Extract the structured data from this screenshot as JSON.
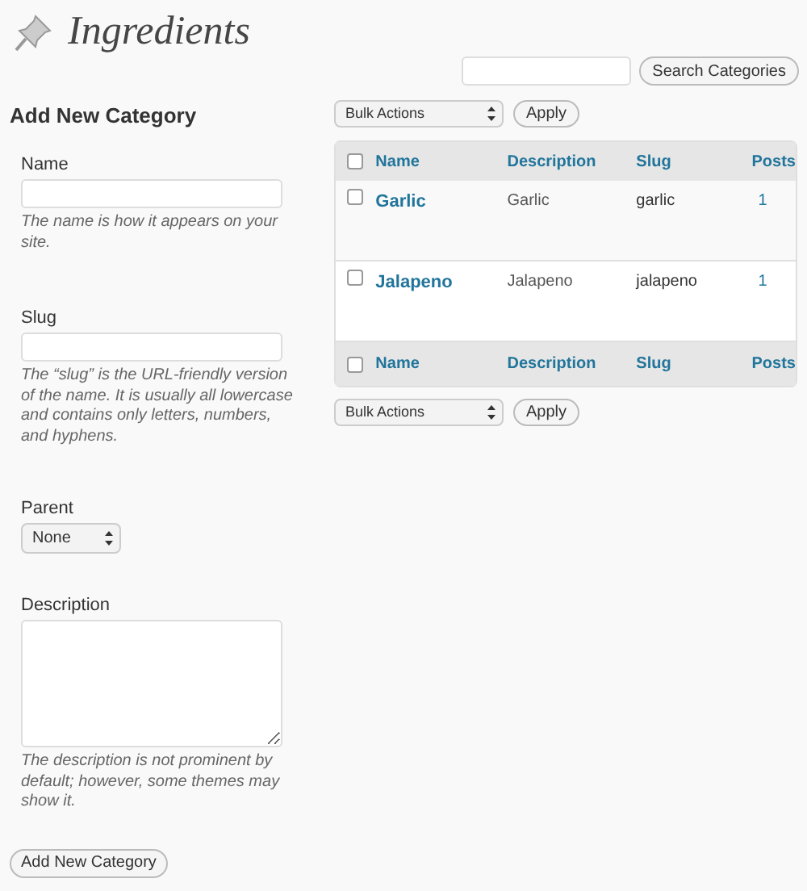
{
  "page_title": "Ingredients",
  "search": {
    "button": "Search Categories"
  },
  "form": {
    "heading": "Add New Category",
    "fields": [
      {
        "kind": "text",
        "label": "Name",
        "hint": "The name is how it appears on your site."
      },
      {
        "kind": "text",
        "label": "Slug",
        "hint": "The “slug” is the URL-friendly version of the name. It is usually all lowercase and contains only letters, numbers, and hyphens."
      },
      {
        "kind": "select",
        "label": "Parent",
        "value": "None"
      },
      {
        "kind": "textarea",
        "label": "Description",
        "hint": "The description is not prominent by default; however, some themes may show it."
      }
    ],
    "submit": "Add New Category"
  },
  "bulk_top": {
    "select": "Bulk Actions",
    "button": "Apply"
  },
  "table": {
    "columns": [
      "Name",
      "Description",
      "Slug",
      "Posts"
    ],
    "rows": [
      {
        "name": "Garlic",
        "description": "Garlic",
        "slug": "garlic",
        "posts": "1",
        "checked": false
      },
      {
        "name": "Jalapeno",
        "description": "Jalapeno",
        "slug": "jalapeno",
        "posts": "1",
        "checked": false
      }
    ],
    "footer_columns": [
      "Name",
      "Description",
      "Slug",
      "Posts"
    ],
    "header_checked": false,
    "footer_checked": false
  },
  "bulk_bottom": {
    "select": "Bulk Actions",
    "button": "Apply"
  }
}
